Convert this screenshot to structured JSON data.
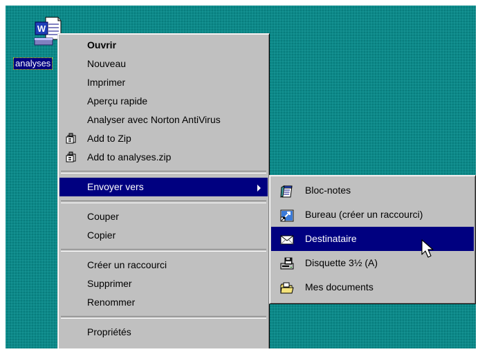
{
  "desktop": {
    "file_label": "analyses",
    "file_icon": "word-document-icon"
  },
  "context_menu": {
    "items": [
      {
        "label": "Ouvrir",
        "bold": true
      },
      {
        "label": "Nouveau"
      },
      {
        "label": "Imprimer"
      },
      {
        "label": "Aperçu rapide"
      },
      {
        "label": "Analyser avec Norton AntiVirus"
      },
      {
        "label": "Add to Zip",
        "icon": "winzip-icon"
      },
      {
        "label": "Add to analyses.zip",
        "icon": "winzip-icon"
      },
      {
        "label": "Envoyer vers",
        "highlighted": true,
        "submenu": true
      },
      {
        "label": "Couper"
      },
      {
        "label": "Copier"
      },
      {
        "label": "Créer un raccourci"
      },
      {
        "label": "Supprimer"
      },
      {
        "label": "Renommer"
      },
      {
        "label": "Propriétés"
      }
    ]
  },
  "send_to_menu": {
    "items": [
      {
        "label": "Bloc-notes",
        "icon": "notepad-icon"
      },
      {
        "label": "Bureau (créer un raccourci)",
        "icon": "desktop-shortcut-icon"
      },
      {
        "label": "Destinataire",
        "icon": "mail-envelope-icon",
        "highlighted": true
      },
      {
        "label": "Disquette 3½ (A)",
        "icon": "floppy-drive-icon"
      },
      {
        "label": "Mes documents",
        "icon": "folder-icon"
      }
    ]
  },
  "colors": {
    "desktop": "#0b8a8a",
    "menu_face": "#c0c0c0",
    "highlight": "#000080",
    "highlight_text": "#ffffff"
  }
}
